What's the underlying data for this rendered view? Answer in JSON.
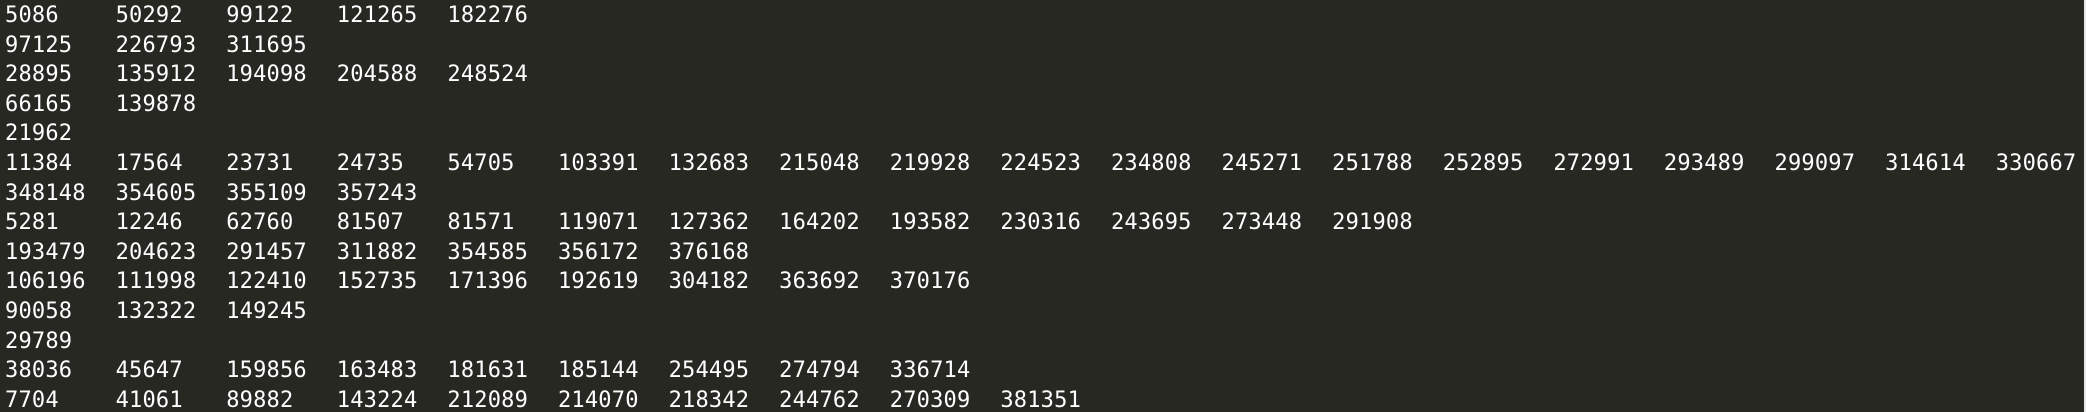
{
  "colors": {
    "background": "#272822",
    "text": "#ffffff"
  },
  "terminal": {
    "rows": [
      [
        "5086",
        "50292",
        "99122",
        "121265",
        "182276"
      ],
      [
        "97125",
        "226793",
        "311695"
      ],
      [
        "28895",
        "135912",
        "194098",
        "204588",
        "248524"
      ],
      [
        "66165",
        "139878"
      ],
      [
        "21962"
      ],
      [
        "11384",
        "17564",
        "23731",
        "24735",
        "54705",
        "103391",
        "132683",
        "215048",
        "219928",
        "224523",
        "234808",
        "245271",
        "251788",
        "252895",
        "272991",
        "293489",
        "299097",
        "314614",
        "330667"
      ],
      [
        "348148",
        "354605",
        "355109",
        "357243"
      ],
      [
        "5281",
        "12246",
        "62760",
        "81507",
        "81571",
        "119071",
        "127362",
        "164202",
        "193582",
        "230316",
        "243695",
        "273448",
        "291908"
      ],
      [
        "193479",
        "204623",
        "291457",
        "311882",
        "354585",
        "356172",
        "376168"
      ],
      [
        "106196",
        "111998",
        "122410",
        "152735",
        "171396",
        "192619",
        "304182",
        "363692",
        "370176"
      ],
      [
        "90058",
        "132322",
        "149245"
      ],
      [
        "29789"
      ],
      [
        "38036",
        "45647",
        "159856",
        "163483",
        "181631",
        "185144",
        "254495",
        "274794",
        "336714"
      ],
      [
        "7704",
        "41061",
        "89882",
        "143224",
        "212089",
        "214070",
        "218342",
        "244762",
        "270309",
        "381351"
      ]
    ]
  }
}
